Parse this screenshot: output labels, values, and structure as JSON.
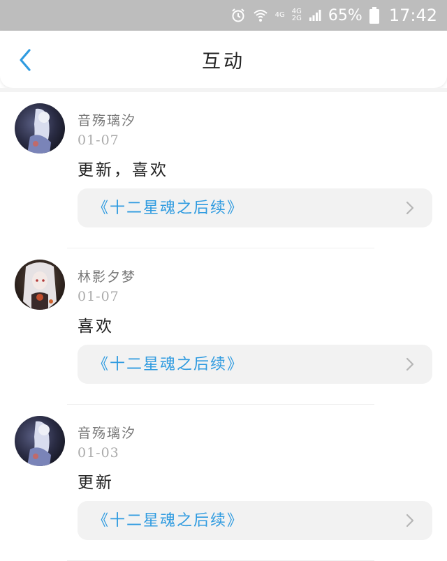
{
  "status_bar": {
    "net_top": "4G",
    "net_bottom": "4G",
    "net_2g": "2G",
    "battery_percent": "65%",
    "time": "17:42",
    "icons": [
      "alarm-icon",
      "wifi-icon",
      "signal-icon",
      "battery-icon"
    ]
  },
  "nav": {
    "title": "互动",
    "back_icon": "chevron-left-icon"
  },
  "colors": {
    "accent": "#2f9be0",
    "status_bar_bg": "#bdbdbd",
    "card_bg": "#f2f2f2"
  },
  "feed": [
    {
      "username": "音殇璃汐",
      "date": "01-07",
      "comment": "更新，喜欢",
      "book_title": "《十二星魂之后续》",
      "avatar": "avatar-1"
    },
    {
      "username": "林影夕梦",
      "date": "01-07",
      "comment": "喜欢",
      "book_title": "《十二星魂之后续》",
      "avatar": "avatar-2"
    },
    {
      "username": "音殇璃汐",
      "date": "01-03",
      "comment": "更新",
      "book_title": "《十二星魂之后续》",
      "avatar": "avatar-1"
    }
  ]
}
